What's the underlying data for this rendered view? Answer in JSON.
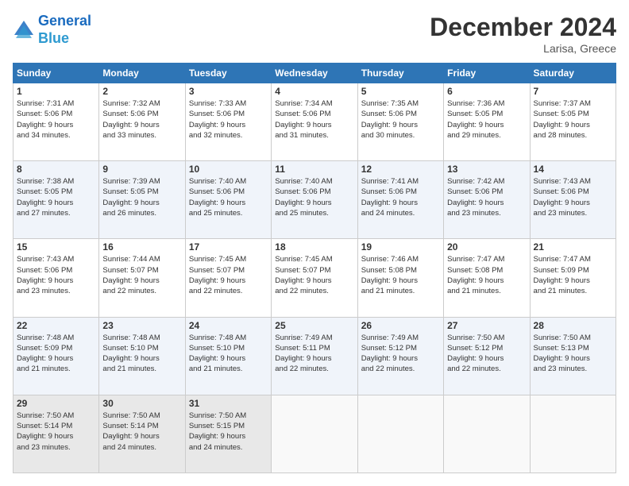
{
  "header": {
    "logo_line1": "General",
    "logo_line2": "Blue",
    "month": "December 2024",
    "location": "Larisa, Greece"
  },
  "weekdays": [
    "Sunday",
    "Monday",
    "Tuesday",
    "Wednesday",
    "Thursday",
    "Friday",
    "Saturday"
  ],
  "weeks": [
    [
      {
        "day": "1",
        "lines": [
          "Sunrise: 7:31 AM",
          "Sunset: 5:06 PM",
          "Daylight: 9 hours",
          "and 34 minutes."
        ]
      },
      {
        "day": "2",
        "lines": [
          "Sunrise: 7:32 AM",
          "Sunset: 5:06 PM",
          "Daylight: 9 hours",
          "and 33 minutes."
        ]
      },
      {
        "day": "3",
        "lines": [
          "Sunrise: 7:33 AM",
          "Sunset: 5:06 PM",
          "Daylight: 9 hours",
          "and 32 minutes."
        ]
      },
      {
        "day": "4",
        "lines": [
          "Sunrise: 7:34 AM",
          "Sunset: 5:06 PM",
          "Daylight: 9 hours",
          "and 31 minutes."
        ]
      },
      {
        "day": "5",
        "lines": [
          "Sunrise: 7:35 AM",
          "Sunset: 5:06 PM",
          "Daylight: 9 hours",
          "and 30 minutes."
        ]
      },
      {
        "day": "6",
        "lines": [
          "Sunrise: 7:36 AM",
          "Sunset: 5:05 PM",
          "Daylight: 9 hours",
          "and 29 minutes."
        ]
      },
      {
        "day": "7",
        "lines": [
          "Sunrise: 7:37 AM",
          "Sunset: 5:05 PM",
          "Daylight: 9 hours",
          "and 28 minutes."
        ]
      }
    ],
    [
      {
        "day": "8",
        "lines": [
          "Sunrise: 7:38 AM",
          "Sunset: 5:05 PM",
          "Daylight: 9 hours",
          "and 27 minutes."
        ]
      },
      {
        "day": "9",
        "lines": [
          "Sunrise: 7:39 AM",
          "Sunset: 5:05 PM",
          "Daylight: 9 hours",
          "and 26 minutes."
        ]
      },
      {
        "day": "10",
        "lines": [
          "Sunrise: 7:40 AM",
          "Sunset: 5:06 PM",
          "Daylight: 9 hours",
          "and 25 minutes."
        ]
      },
      {
        "day": "11",
        "lines": [
          "Sunrise: 7:40 AM",
          "Sunset: 5:06 PM",
          "Daylight: 9 hours",
          "and 25 minutes."
        ]
      },
      {
        "day": "12",
        "lines": [
          "Sunrise: 7:41 AM",
          "Sunset: 5:06 PM",
          "Daylight: 9 hours",
          "and 24 minutes."
        ]
      },
      {
        "day": "13",
        "lines": [
          "Sunrise: 7:42 AM",
          "Sunset: 5:06 PM",
          "Daylight: 9 hours",
          "and 23 minutes."
        ]
      },
      {
        "day": "14",
        "lines": [
          "Sunrise: 7:43 AM",
          "Sunset: 5:06 PM",
          "Daylight: 9 hours",
          "and 23 minutes."
        ]
      }
    ],
    [
      {
        "day": "15",
        "lines": [
          "Sunrise: 7:43 AM",
          "Sunset: 5:06 PM",
          "Daylight: 9 hours",
          "and 23 minutes."
        ]
      },
      {
        "day": "16",
        "lines": [
          "Sunrise: 7:44 AM",
          "Sunset: 5:07 PM",
          "Daylight: 9 hours",
          "and 22 minutes."
        ]
      },
      {
        "day": "17",
        "lines": [
          "Sunrise: 7:45 AM",
          "Sunset: 5:07 PM",
          "Daylight: 9 hours",
          "and 22 minutes."
        ]
      },
      {
        "day": "18",
        "lines": [
          "Sunrise: 7:45 AM",
          "Sunset: 5:07 PM",
          "Daylight: 9 hours",
          "and 22 minutes."
        ]
      },
      {
        "day": "19",
        "lines": [
          "Sunrise: 7:46 AM",
          "Sunset: 5:08 PM",
          "Daylight: 9 hours",
          "and 21 minutes."
        ]
      },
      {
        "day": "20",
        "lines": [
          "Sunrise: 7:47 AM",
          "Sunset: 5:08 PM",
          "Daylight: 9 hours",
          "and 21 minutes."
        ]
      },
      {
        "day": "21",
        "lines": [
          "Sunrise: 7:47 AM",
          "Sunset: 5:09 PM",
          "Daylight: 9 hours",
          "and 21 minutes."
        ]
      }
    ],
    [
      {
        "day": "22",
        "lines": [
          "Sunrise: 7:48 AM",
          "Sunset: 5:09 PM",
          "Daylight: 9 hours",
          "and 21 minutes."
        ]
      },
      {
        "day": "23",
        "lines": [
          "Sunrise: 7:48 AM",
          "Sunset: 5:10 PM",
          "Daylight: 9 hours",
          "and 21 minutes."
        ]
      },
      {
        "day": "24",
        "lines": [
          "Sunrise: 7:48 AM",
          "Sunset: 5:10 PM",
          "Daylight: 9 hours",
          "and 21 minutes."
        ]
      },
      {
        "day": "25",
        "lines": [
          "Sunrise: 7:49 AM",
          "Sunset: 5:11 PM",
          "Daylight: 9 hours",
          "and 22 minutes."
        ]
      },
      {
        "day": "26",
        "lines": [
          "Sunrise: 7:49 AM",
          "Sunset: 5:12 PM",
          "Daylight: 9 hours",
          "and 22 minutes."
        ]
      },
      {
        "day": "27",
        "lines": [
          "Sunrise: 7:50 AM",
          "Sunset: 5:12 PM",
          "Daylight: 9 hours",
          "and 22 minutes."
        ]
      },
      {
        "day": "28",
        "lines": [
          "Sunrise: 7:50 AM",
          "Sunset: 5:13 PM",
          "Daylight: 9 hours",
          "and 23 minutes."
        ]
      }
    ],
    [
      {
        "day": "29",
        "lines": [
          "Sunrise: 7:50 AM",
          "Sunset: 5:14 PM",
          "Daylight: 9 hours",
          "and 23 minutes."
        ]
      },
      {
        "day": "30",
        "lines": [
          "Sunrise: 7:50 AM",
          "Sunset: 5:14 PM",
          "Daylight: 9 hours",
          "and 24 minutes."
        ]
      },
      {
        "day": "31",
        "lines": [
          "Sunrise: 7:50 AM",
          "Sunset: 5:15 PM",
          "Daylight: 9 hours",
          "and 24 minutes."
        ]
      },
      null,
      null,
      null,
      null
    ]
  ]
}
